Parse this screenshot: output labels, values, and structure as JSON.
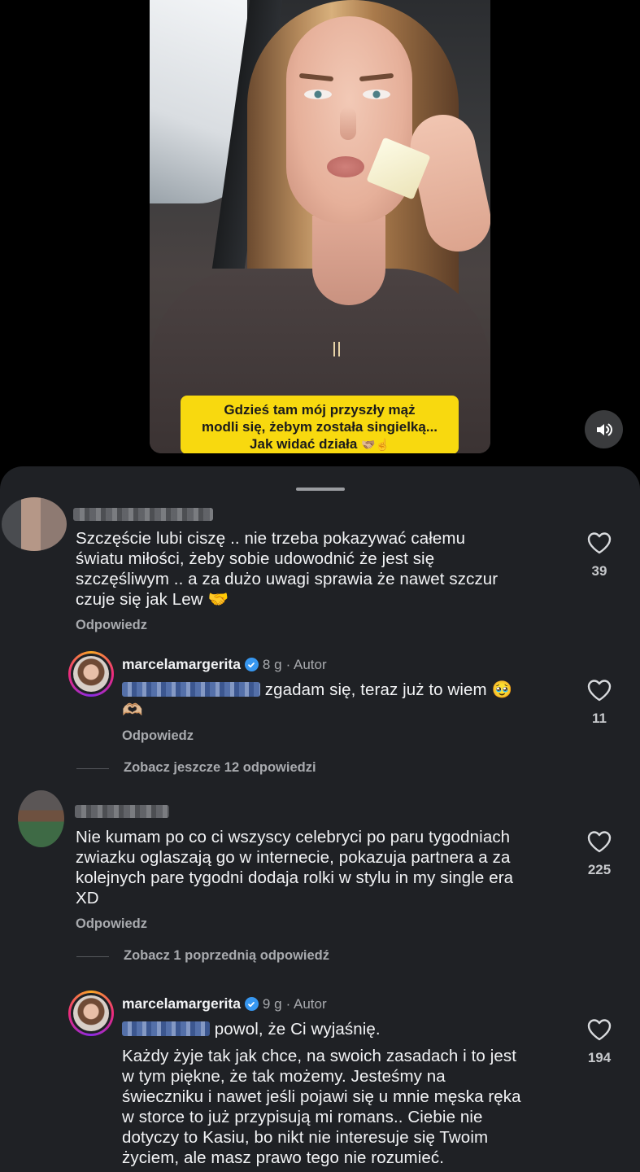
{
  "video": {
    "caption_lines": [
      "Gdzieś tam mój przyszły mąż",
      "modli się, żebym została singielką...",
      "Jak widać działa"
    ],
    "caption_emoji": "🫱🏼‍🫲🏽☝️",
    "sound_icon": "speaker-icon"
  },
  "comments": [
    {
      "text_lines": [
        "Szczęście lubi ciszę .. nie trzeba pokazywać całemu",
        "światu miłości, żeby sobie udowodnić że jest się",
        "szczęśliwym .. a za dużo uwagi sprawia że nawet szczur",
        "czuje się jak Lew 🤝"
      ],
      "reply_label": "Odpowiedz",
      "likes": "39",
      "replies": [
        {
          "username": "marcelamargerita",
          "time": "8 g",
          "author_label": "· Autor",
          "text": "zgadam się, teraz już to wiem 🥹",
          "text_line2": "🫶🏼",
          "reply_label": "Odpowiedz",
          "likes": "11"
        }
      ],
      "more_replies": "Zobacz jeszcze 12 odpowiedzi"
    },
    {
      "text_lines": [
        "Nie kumam po co ci wszyscy celebryci po paru tygodniach",
        "zwiazku oglaszają go w internecie, pokazuja partnera a za",
        "kolejnych pare tygodni dodaja rolki w stylu in my single era",
        "XD"
      ],
      "reply_label": "Odpowiedz",
      "likes": "225",
      "more_replies": "Zobacz 1 poprzednią odpowiedź",
      "replies": [
        {
          "username": "marcelamargerita",
          "time": "9 g",
          "author_label": "· Autor",
          "text": "powol, że Ci wyjaśnię.",
          "body_lines": [
            "Każdy żyje tak jak chce, na swoich zasadach i to jest",
            "w tym piękne, że tak możemy. Jesteśmy na",
            "świeczniku i nawet jeśli pojawi się u mnie męska ręka",
            "w storce to już przypisują mi romans.. Ciebie nie",
            "dotyczy to Kasiu, bo nikt nie interesuje się Twoim",
            "życiem, ale masz prawo tego nie rozumieć."
          ],
          "likes": "194"
        }
      ]
    }
  ],
  "colors": {
    "sheet_bg": "#1f2125",
    "caption_bg": "#f8d90f",
    "verified": "#3797f0",
    "muted_text": "#a8aaae"
  }
}
